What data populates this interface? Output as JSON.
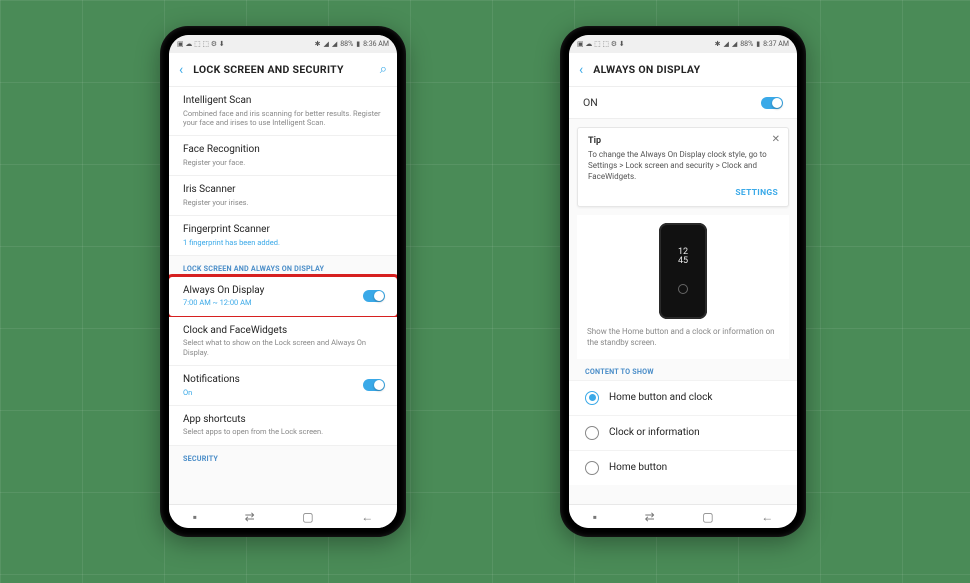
{
  "status": {
    "battery": "88%",
    "time_left": "8:36 AM",
    "time_right": "8:37 AM"
  },
  "left": {
    "header_title": "LOCK SCREEN AND SECURITY",
    "rows": [
      {
        "label": "Intelligent Scan",
        "sub": "Combined face and iris scanning for better results. Register your face and irises to use Intelligent Scan."
      },
      {
        "label": "Face Recognition",
        "sub": "Register your face."
      },
      {
        "label": "Iris Scanner",
        "sub": "Register your irises."
      },
      {
        "label": "Fingerprint Scanner",
        "sub": "1 fingerprint has been added.",
        "link": true
      }
    ],
    "section1": "LOCK SCREEN AND ALWAYS ON DISPLAY",
    "aod": {
      "label": "Always On Display",
      "sub": "7:00 AM ~ 12:00 AM",
      "on": true
    },
    "clock": {
      "label": "Clock and FaceWidgets",
      "sub": "Select what to show on the Lock screen and Always On Display."
    },
    "notif": {
      "label": "Notifications",
      "sub": "On",
      "on": true
    },
    "shortcuts": {
      "label": "App shortcuts",
      "sub": "Select apps to open from the Lock screen."
    },
    "section2": "SECURITY"
  },
  "right": {
    "header_title": "ALWAYS ON DISPLAY",
    "on_label": "ON",
    "tip": {
      "title": "Tip",
      "text": "To change the Always On Display clock style, go to Settings > Lock screen and security > Clock and FaceWidgets.",
      "settings": "SETTINGS"
    },
    "preview": {
      "clock_top": "12",
      "clock_bottom": "45",
      "desc": "Show the Home button and a clock or information on the standby screen."
    },
    "content_hdr": "CONTENT TO SHOW",
    "options": [
      {
        "label": "Home button and clock",
        "checked": true
      },
      {
        "label": "Clock or information",
        "checked": false
      },
      {
        "label": "Home button",
        "checked": false
      }
    ]
  }
}
